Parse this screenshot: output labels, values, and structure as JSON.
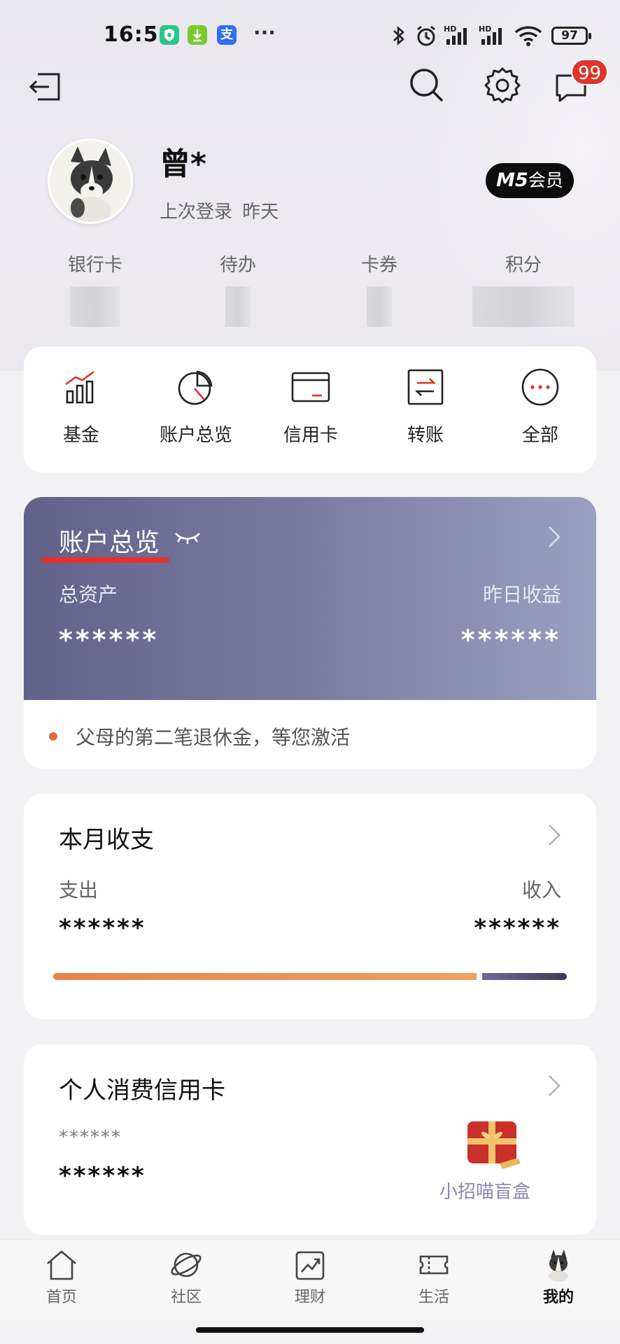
{
  "status_bar": {
    "time": "16:54",
    "app_icon_1": "shield-app-icon",
    "app_icon_2": "download-app-icon",
    "app_icon_3_label": "支",
    "more": "···",
    "battery": "97"
  },
  "header": {
    "message_badge": "99"
  },
  "profile": {
    "name": "曾*",
    "last_login_label": "上次登录",
    "last_login_value": "昨天",
    "member_level": "M5",
    "member_suffix": "会员"
  },
  "stats": [
    {
      "label": "银行卡"
    },
    {
      "label": "待办"
    },
    {
      "label": "卡券"
    },
    {
      "label": "积分"
    }
  ],
  "quick_actions": [
    {
      "label": "基金",
      "icon": "fund-chart-icon"
    },
    {
      "label": "账户总览",
      "icon": "pie-chart-icon"
    },
    {
      "label": "信用卡",
      "icon": "credit-card-icon"
    },
    {
      "label": "转账",
      "icon": "transfer-icon"
    },
    {
      "label": "全部",
      "icon": "more-dots-icon"
    }
  ],
  "account_overview": {
    "title": "账户总览",
    "total_assets_label": "总资产",
    "total_assets_value": "******",
    "yesterday_income_label": "昨日收益",
    "yesterday_income_value": "******",
    "notice": "父母的第二笔退休金，等您激活"
  },
  "monthly": {
    "title": "本月收支",
    "expense_label": "支出",
    "expense_value": "******",
    "income_label": "收入",
    "income_value": "******",
    "expense_ratio": 0.83
  },
  "credit_card": {
    "title": "个人消费信用卡",
    "masked_number": "******",
    "value": "******",
    "promo_label": "小招喵盲盒"
  },
  "tabbar": [
    {
      "label": "首页",
      "icon": "home-icon"
    },
    {
      "label": "社区",
      "icon": "planet-icon"
    },
    {
      "label": "理财",
      "icon": "trend-chart-icon"
    },
    {
      "label": "生活",
      "icon": "ticket-icon"
    },
    {
      "label": "我的",
      "icon": "avatar-icon"
    }
  ],
  "colors": {
    "accent_red": "#e3322a",
    "card_purple_start": "#62618a",
    "card_purple_end": "#9aa0c0",
    "expense_orange": "#e8824b",
    "income_dark": "#3c3c58"
  }
}
